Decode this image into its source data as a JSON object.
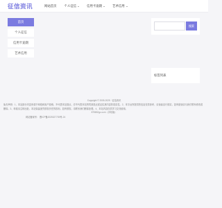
{
  "header": {
    "logo": "征信资讯",
    "nav": [
      {
        "label": "网站首页",
        "caret": false
      },
      {
        "label": "个人征信",
        "caret": true
      },
      {
        "label": "信用卡逾期",
        "caret": true
      },
      {
        "label": "艺术信用",
        "caret": true
      }
    ]
  },
  "sidebar": {
    "items": [
      {
        "label": "首页",
        "active": true
      },
      {
        "label": "个人征信",
        "active": false
      },
      {
        "label": "信用卡逾期",
        "active": false
      },
      {
        "label": "艺术信用",
        "active": false
      }
    ]
  },
  "search": {
    "placeholder": "",
    "button_label": "搜索"
  },
  "tags": {
    "title": "标签列表"
  },
  "footer": {
    "copyright": "Copyright © 2005-2025 · 征信资讯",
    "disclaimer": "免责声明：1、本站部分内容来源于网络和用户投稿，不代表本站观点，亦不代表本站赞同其观点或证实其内容的真实性。2、本平台所提供的信息仅供参考，请读者自行核实，如有错误请与我们联系修改或删除。3、转载请注明出处，本站保留追究侵权责任的权利。如有侵权，请联系我们删除处理。4、本站内容仅供学习交流使用。",
    "site_info": "875832gc.com（手机版）",
    "icp": "网站备案号：    晋ICP备2025327739号-24"
  },
  "colors": {
    "accent": "#7b7be0",
    "background": "#f5f5f8",
    "panel": "#ffffff"
  }
}
